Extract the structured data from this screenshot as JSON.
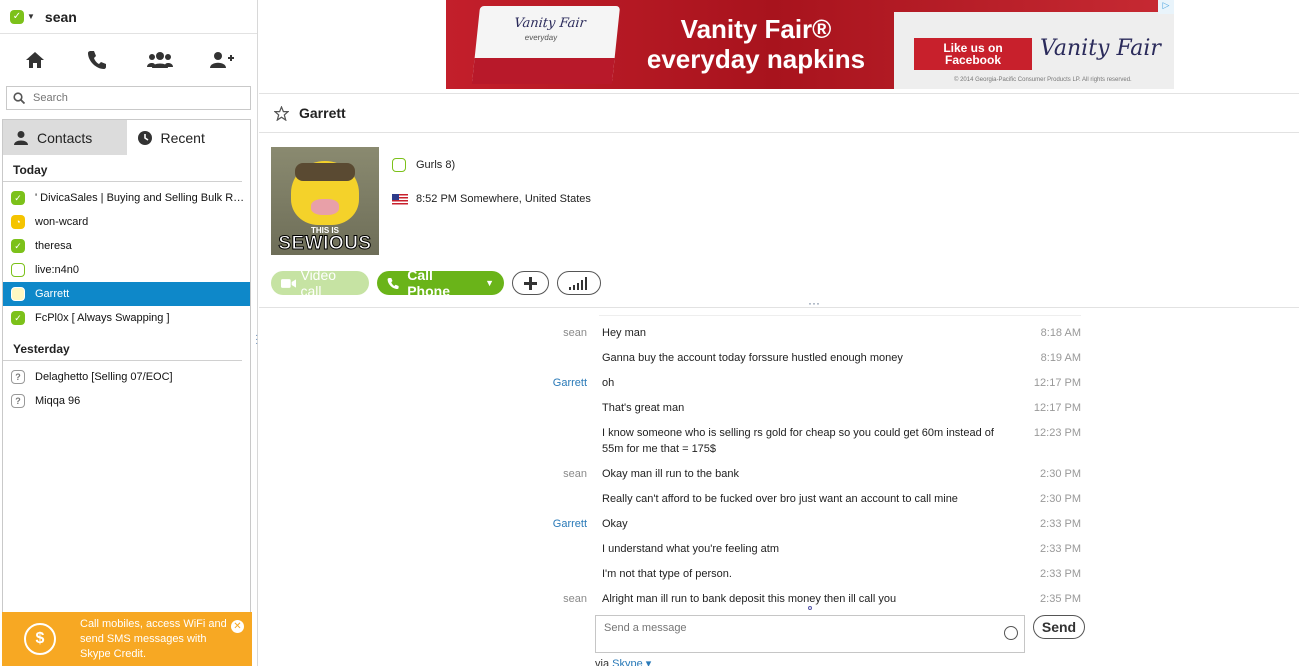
{
  "profile": {
    "username": "sean"
  },
  "search": {
    "placeholder": "Search"
  },
  "tabs": {
    "contacts": "Contacts",
    "recent": "Recent"
  },
  "groups": {
    "today": "Today",
    "yesterday": "Yesterday"
  },
  "contacts_today": [
    {
      "name": "' DivicaSales | Buying and Selling Bulk Rs G...",
      "status": "online"
    },
    {
      "name": "won-wcard",
      "status": "away"
    },
    {
      "name": "theresa",
      "status": "online"
    },
    {
      "name": "live:n4n0",
      "status": "offline"
    },
    {
      "name": "Garrett",
      "status": "offline",
      "selected": true
    },
    {
      "name": "FcPl0x [ Always Swapping ]",
      "status": "online"
    }
  ],
  "contacts_yesterday": [
    {
      "name": "Delaghetto [Selling 07/EOC]",
      "status": "unknown"
    },
    {
      "name": "Miqqa 96",
      "status": "unknown"
    }
  ],
  "promo": {
    "text": "Call mobiles, access WiFi and send SMS messages with Skype Credit."
  },
  "ad": {
    "brand": "Vanity Fair",
    "napkin_sub": "everyday",
    "headline_line1": "Vanity Fair®",
    "headline_line2": "everyday napkins",
    "like_line1": "Like us on",
    "like_line2": "Facebook",
    "copyright": "© 2014 Georgia-Pacific Consumer Products LP. All rights reserved."
  },
  "conversation": {
    "name": "Garrett",
    "mood": "Gurls 8)",
    "location": "8:52 PM Somewhere, United States",
    "avatar_caption_small": "THIS IS",
    "avatar_caption_big": "SEWIOUS"
  },
  "actions": {
    "video": "Video call",
    "call": "Call Phone"
  },
  "messages": [
    {
      "author": "sean",
      "text": "Hey man",
      "time": "8:18 AM"
    },
    {
      "author": "",
      "text": "Ganna buy the account today forssure hustled enough money",
      "time": "8:19 AM"
    },
    {
      "author": "Garrett",
      "text": "oh",
      "time": "12:17 PM"
    },
    {
      "author": "",
      "text": "That's great man",
      "time": "12:17 PM"
    },
    {
      "author": "",
      "text": "I know someone who is selling rs gold for cheap so you could get 60m instead of 55m for me that = 175$",
      "time": "12:23 PM"
    },
    {
      "author": "sean",
      "text": "Okay man ill run to the bank",
      "time": "2:30 PM"
    },
    {
      "author": "",
      "text": "Really can't afford to be fucked over bro just want an account to call mine",
      "time": "2:30 PM"
    },
    {
      "author": "Garrett",
      "text": "Okay",
      "time": "2:33 PM"
    },
    {
      "author": "",
      "text": "I understand what you're feeling atm",
      "time": "2:33 PM"
    },
    {
      "author": "",
      "text": "I'm not that type of person.",
      "time": "2:33 PM"
    },
    {
      "author": "sean",
      "text": "Alright man ill run to bank deposit this money then ill call you",
      "time": "2:35 PM"
    }
  ],
  "composer": {
    "placeholder": "Send a message",
    "send": "Send",
    "via_prefix": "via",
    "via_link": "Skype ▾"
  },
  "colors": {
    "online": "#7cc11a",
    "away": "#f5c400",
    "selected": "#0e88c9",
    "promo": "#f7a823",
    "call": "#6ab419"
  },
  "icons": [
    "home-icon",
    "phone-icon",
    "contacts-group-icon",
    "add-contact-icon",
    "search-icon",
    "person-icon",
    "clock-icon",
    "star-icon",
    "plus-icon",
    "signal-bars-icon",
    "emoticon-icon"
  ]
}
